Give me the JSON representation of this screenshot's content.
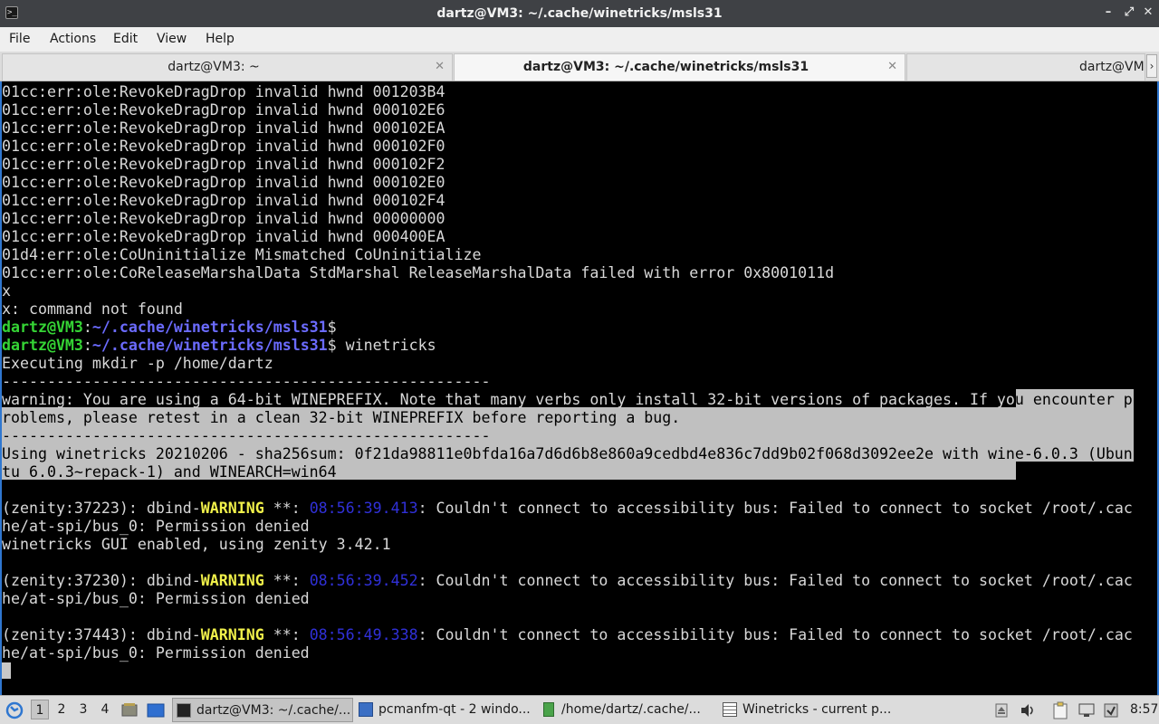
{
  "window": {
    "title": "dartz@VM3: ~/.cache/winetricks/msls31",
    "minimize_glyph": "–",
    "maximize_glyph": "⤢",
    "close_glyph": "✕"
  },
  "menu": [
    "File",
    "Actions",
    "Edit",
    "View",
    "Help"
  ],
  "tabs": [
    {
      "label": "dartz@VM3: ~",
      "active": false
    },
    {
      "label": "dartz@VM3: ~/.cache/winetricks/msls31",
      "active": true
    },
    {
      "label": "dartz@VM3",
      "active": false
    }
  ],
  "tab_close_glyph": "✕",
  "tab_scroll_glyph": "›",
  "terminal": {
    "lines": [
      "01cc:err:ole:RevokeDragDrop invalid hwnd 001203B4",
      "01cc:err:ole:RevokeDragDrop invalid hwnd 000102E6",
      "01cc:err:ole:RevokeDragDrop invalid hwnd 000102EA",
      "01cc:err:ole:RevokeDragDrop invalid hwnd 000102F0",
      "01cc:err:ole:RevokeDragDrop invalid hwnd 000102F2",
      "01cc:err:ole:RevokeDragDrop invalid hwnd 000102E0",
      "01cc:err:ole:RevokeDragDrop invalid hwnd 000102F4",
      "01cc:err:ole:RevokeDragDrop invalid hwnd 00000000",
      "01cc:err:ole:RevokeDragDrop invalid hwnd 000400EA",
      "01d4:err:ole:CoUninitialize Mismatched CoUninitialize",
      "01cc:err:ole:CoReleaseMarshalData StdMarshal ReleaseMarshalData failed with error 0x8001011d",
      "x",
      "x: command not found"
    ],
    "prompt_user": "dartz@VM3",
    "prompt_sep": ":",
    "prompt_path": "~/.cache/winetricks/msls31",
    "prompt_dollar": "$",
    "command": " winetricks",
    "exec_line": "Executing mkdir -p /home/dartz",
    "dash_line": "------------------------------------------------------",
    "warn1_a": "warning: You are using a 64-bit WINEPREFIX. Note that many verbs only install 32-bit versions of packages. If yo",
    "warn1_b": "u encounter p",
    "warn2": "roblems, please retest in a clean 32-bit WINEPREFIX before reporting a bug.",
    "using1": "Using winetricks 20210206 - sha256sum: 0f21da98811e0bfda16a7d6d6b8e860a9cedbd4e836c7dd9b02f068d3092ee2e with wine-6.0.3 (Ubun",
    "using2": "tu 6.0.3~repack-1) and WINEARCH=win64",
    "dbind": [
      {
        "pre": "(zenity:37223): dbind-",
        "warn": "WARNING",
        "mid": " **: ",
        "time": "08:56:39.413",
        "post": ": Couldn't connect to accessibility bus: Failed to connect to socket /root/.cac",
        "cont": "he/at-spi/bus_0: Permission denied"
      },
      {
        "pre": "(zenity:37230): dbind-",
        "warn": "WARNING",
        "mid": " **: ",
        "time": "08:56:39.452",
        "post": ": Couldn't connect to accessibility bus: Failed to connect to socket /root/.cac",
        "cont": "he/at-spi/bus_0: Permission denied"
      },
      {
        "pre": "(zenity:37443): dbind-",
        "warn": "WARNING",
        "mid": " **: ",
        "time": "08:56:49.338",
        "post": ": Couldn't connect to accessibility bus: Failed to connect to socket /root/.cac",
        "cont": "he/at-spi/bus_0: Permission denied"
      }
    ],
    "gui_line": "winetricks GUI enabled, using zenity 3.42.1"
  },
  "taskbar": {
    "desktops": [
      "1",
      "2",
      "3",
      "4"
    ],
    "tasks": [
      {
        "label": "dartz@VM3: ~/.cache/...",
        "icon": "terminal-icon",
        "active": true
      },
      {
        "label": "pcmanfm-qt - 2 windo...",
        "icon": "folder-icon",
        "active": false
      },
      {
        "label": "/home/dartz/.cache/...",
        "icon": "archive-icon",
        "active": false
      },
      {
        "label": "Winetricks - current p...",
        "icon": "list-window-icon",
        "active": false
      }
    ],
    "clock": "8:57"
  },
  "colors": {
    "prompt_user": "#35d435",
    "prompt_path": "#6b6bff",
    "warning": "#f0f04a",
    "timestamp": "#3030d8",
    "selection": "#c0c0c0",
    "accent_border": "#2f77d0"
  }
}
